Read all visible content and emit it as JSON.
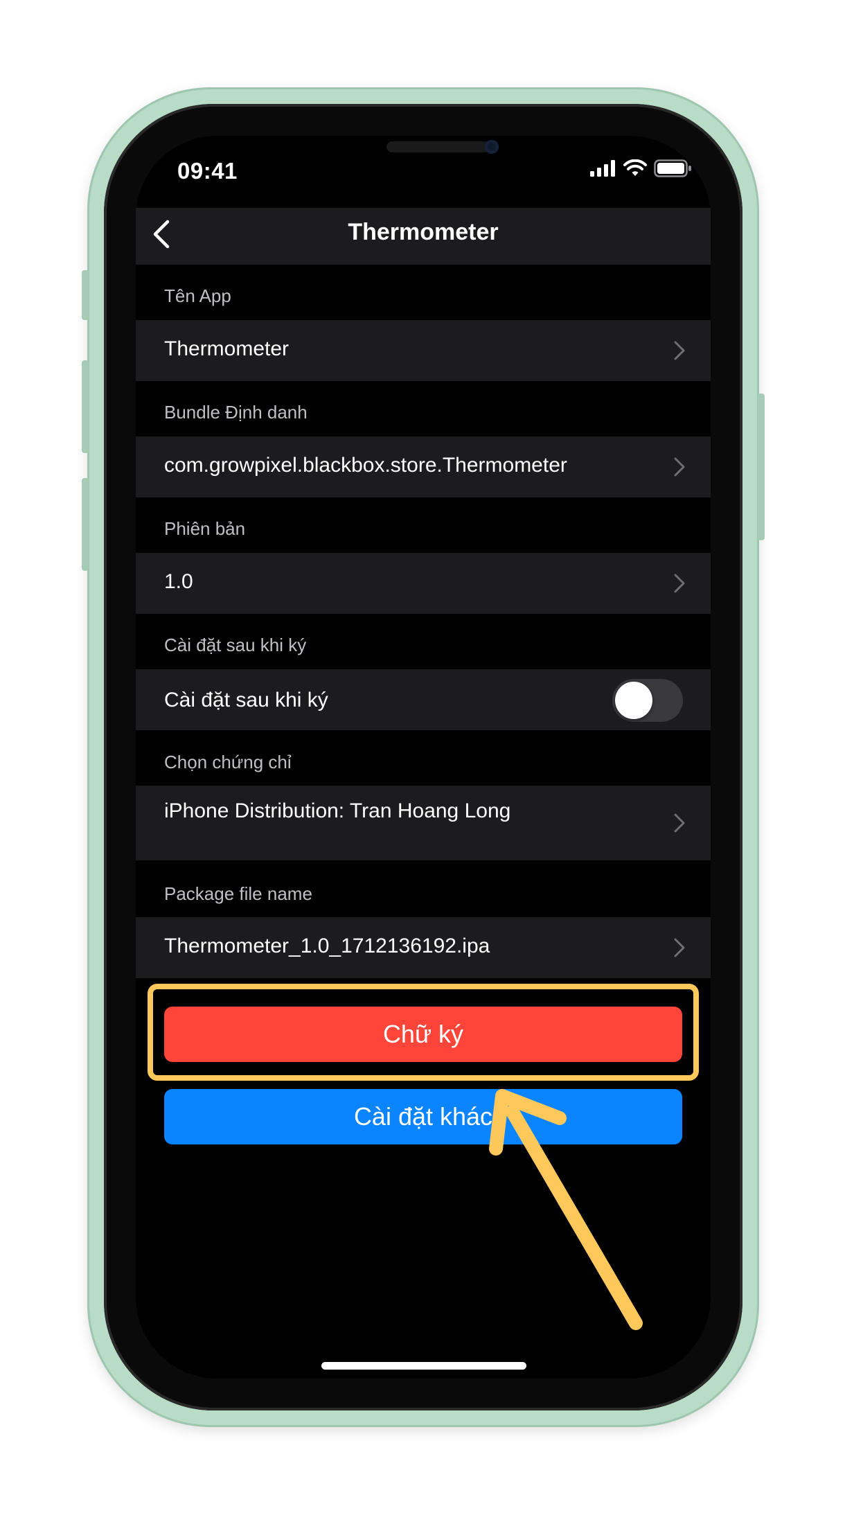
{
  "status_bar": {
    "time": "09:41",
    "icons": [
      "signal-icon",
      "wifi-icon",
      "battery-icon"
    ]
  },
  "nav": {
    "title": "Thermometer",
    "back_icon": "chevron-left-icon"
  },
  "sections": [
    {
      "label": "Tên App",
      "value": "Thermometer"
    },
    {
      "label": "Bundle Định danh",
      "value": "com.growpixel.blackbox.store.Thermometer"
    },
    {
      "label": "Phiên bản",
      "value": "1.0"
    },
    {
      "label": "Cài đặt sau khi ký",
      "value": "Cài đặt sau khi ký"
    },
    {
      "label": "Chọn chứng chỉ",
      "value": "iPhone Distribution: Tran Hoang Long"
    },
    {
      "label": "Package file name",
      "value": "Thermometer_1.0_1712136192.ipa"
    }
  ],
  "toggle": {
    "on": false
  },
  "buttons": {
    "sign": "Chữ ký",
    "other_install": "Cài đặt khác"
  },
  "colors": {
    "sign_button": "#ff453a",
    "other_button": "#0a84ff",
    "highlight": "#ffc85a",
    "row_bg": "#1c1c1e",
    "phone_frame": "#b8dcc6"
  }
}
